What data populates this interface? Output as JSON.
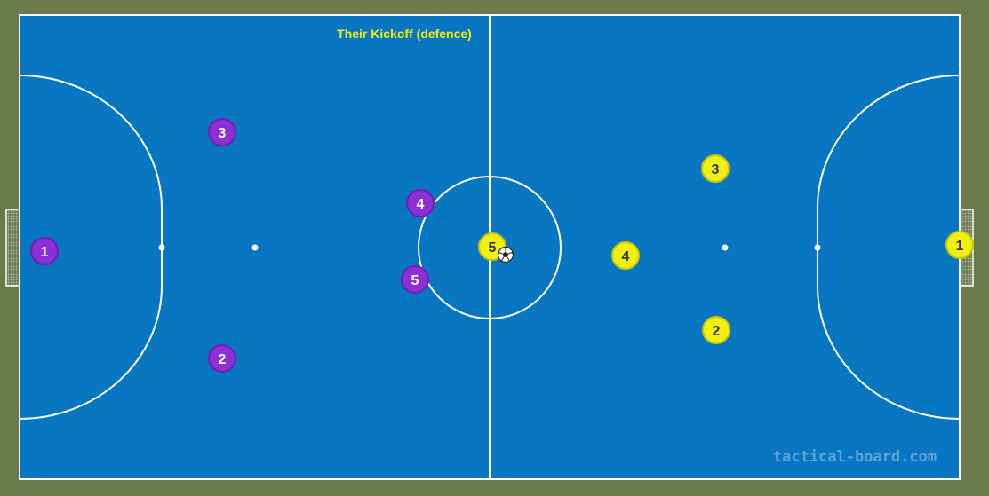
{
  "title": "Their Kickoff (defence)",
  "watermark": "tactical-board.com",
  "colors": {
    "background": "#6b7a4b",
    "pitch": "#0876c1",
    "lines": "#ffffff",
    "title": "#f4ef11",
    "team_purple": "#8c2fd6",
    "team_yellow": "#f2ef12",
    "watermark": "#5fa4d6"
  },
  "ball_icon": "soccer-ball",
  "teams": {
    "purple": {
      "players": [
        {
          "number": "1"
        },
        {
          "number": "2"
        },
        {
          "number": "3"
        },
        {
          "number": "4"
        },
        {
          "number": "5"
        }
      ]
    },
    "yellow": {
      "players": [
        {
          "number": "1"
        },
        {
          "number": "2"
        },
        {
          "number": "3"
        },
        {
          "number": "4"
        },
        {
          "number": "5"
        }
      ]
    }
  }
}
